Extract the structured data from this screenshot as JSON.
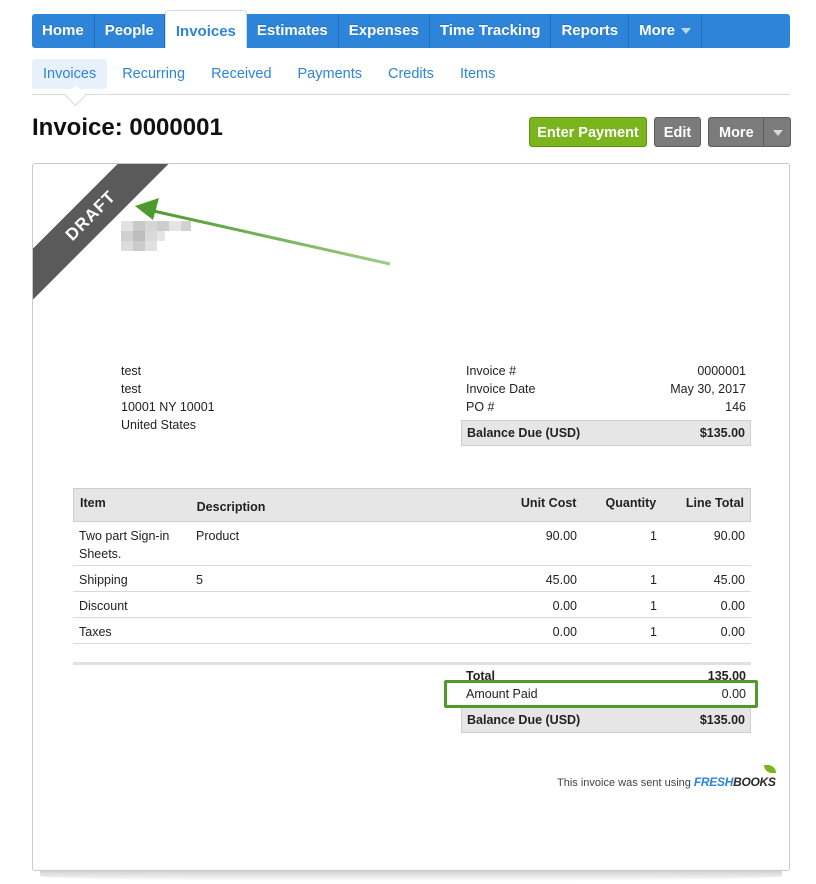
{
  "nav": {
    "tabs": [
      "Home",
      "People",
      "Invoices",
      "Estimates",
      "Expenses",
      "Time Tracking",
      "Reports",
      "More"
    ],
    "active": "Invoices"
  },
  "subnav": {
    "items": [
      "Invoices",
      "Recurring",
      "Received",
      "Payments",
      "Credits",
      "Items"
    ],
    "active": "Invoices"
  },
  "header": {
    "title": "Invoice: 0000001",
    "enter_payment": "Enter Payment",
    "edit": "Edit",
    "more": "More"
  },
  "invoice": {
    "status": "DRAFT",
    "client_lines": [
      "test",
      "test",
      "10001 NY  10001",
      "United States"
    ],
    "meta": [
      {
        "label": "Invoice #",
        "value": "0000001"
      },
      {
        "label": "Invoice Date",
        "value": "May 30, 2017"
      },
      {
        "label": "PO #",
        "value": "146"
      }
    ],
    "balance_due_label": "Balance Due (USD)",
    "balance_due": "$135.00",
    "columns": {
      "item": "Item",
      "description": "Description",
      "unit_cost": "Unit Cost",
      "quantity": "Quantity",
      "line_total": "Line Total"
    },
    "rows": [
      {
        "item": "Two part Sign-in Sheets.",
        "description": "Product",
        "unit_cost": "90.00",
        "quantity": "1",
        "line_total": "90.00"
      },
      {
        "item": "Shipping",
        "description": "5",
        "unit_cost": "45.00",
        "quantity": "1",
        "line_total": "45.00"
      },
      {
        "item": "Discount",
        "description": "",
        "unit_cost": "0.00",
        "quantity": "1",
        "line_total": "0.00"
      },
      {
        "item": "Taxes",
        "description": "",
        "unit_cost": "0.00",
        "quantity": "1",
        "line_total": "0.00"
      }
    ],
    "total_label": "Total",
    "total": "135.00",
    "amount_paid_label": "Amount Paid",
    "amount_paid": "0.00",
    "footer_text": "This invoice was sent using",
    "brand_fresh": "FRESH",
    "brand_books": "BOOKS"
  },
  "colors": {
    "nav_blue": "#2d84d8",
    "pay_green": "#7ab51d",
    "highlight_green": "#4e9a2c",
    "ribbon_gray": "#5a5a5a"
  }
}
